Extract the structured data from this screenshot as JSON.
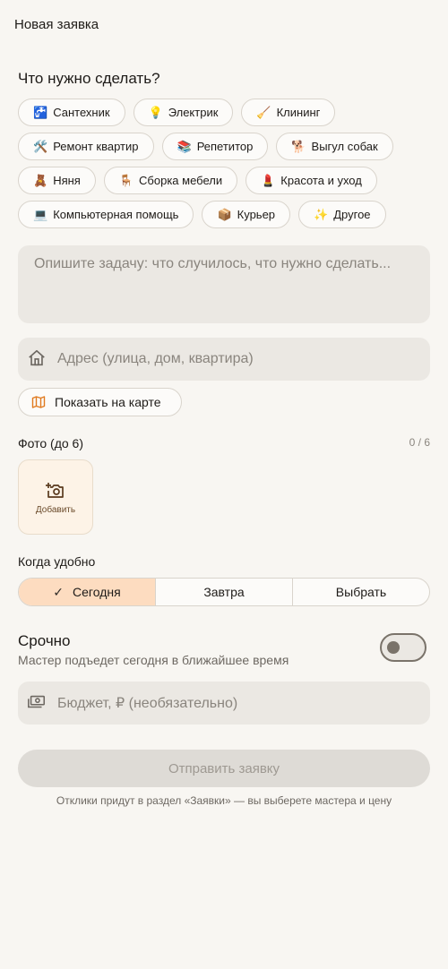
{
  "app_title": "Новая заявка",
  "categories_title": "Что нужно сделать?",
  "categories": [
    [
      {
        "emoji": "🚰",
        "label": "Сантехник"
      },
      {
        "emoji": "💡",
        "label": "Электрик"
      },
      {
        "emoji": "🧹",
        "label": "Клининг"
      }
    ],
    [
      {
        "emoji": "🛠️",
        "label": "Ремонт квартир"
      },
      {
        "emoji": "📚",
        "label": "Репетитор"
      },
      {
        "emoji": "🐕",
        "label": "Выгул собак"
      }
    ],
    [
      {
        "emoji": "🧸",
        "label": "Няня"
      },
      {
        "emoji": "🪑",
        "label": "Сборка мебели"
      },
      {
        "emoji": "💄",
        "label": "Красота и уход"
      }
    ],
    [
      {
        "emoji": "💻",
        "label": "Компьютерная помощь"
      },
      {
        "emoji": "📦",
        "label": "Курьер"
      },
      {
        "emoji": "✨",
        "label": "Другое"
      }
    ]
  ],
  "description": {
    "placeholder": "Опишите задачу: что случилось, что нужно сделать..."
  },
  "address": {
    "placeholder": "Адрес (улица, дом, квартира)",
    "icon": "home-icon"
  },
  "map_button": {
    "label": "Показать на карте",
    "icon": "map-icon",
    "icon_color": "#e07a1f"
  },
  "photos": {
    "label": "Фото (до 6)",
    "counter": "0 / 6",
    "add_label": "Добавить",
    "icon": "add-photo-icon"
  },
  "when": {
    "label": "Когда удобно",
    "options": [
      "Сегодня",
      "Завтра",
      "Выбрать"
    ],
    "selected": "Сегодня",
    "selected_color": "#fddcc0"
  },
  "urgent": {
    "title": "Срочно",
    "subtitle": "Мастер подъедет сегодня в ближайшее время",
    "enabled": false
  },
  "budget": {
    "placeholder": "Бюджет, ₽ (необязательно)",
    "icon": "money-icon"
  },
  "submit": {
    "label": "Отправить заявку",
    "disabled": true
  },
  "footnote": "Отклики придут в раздел «Заявки» — вы выберете мастера и цену",
  "colors": {
    "background": "#f8f6f2",
    "field": "#ebe8e3",
    "accent": "#e07a1f"
  }
}
